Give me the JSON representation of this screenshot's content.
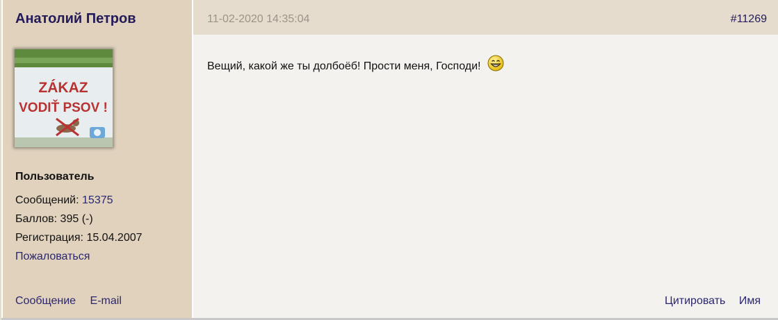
{
  "author": {
    "name": "Анатолий Петров",
    "avatar_text_line1": "ZÁKAZ",
    "avatar_text_line2": "VODIŤ PSOV !",
    "role": "Пользователь",
    "messages_label": "Сообщений:",
    "messages_count": "15375",
    "points_label": "Баллов:",
    "points_value": "395 (-)",
    "registration_label": "Регистрация:",
    "registration_date": "15.04.2007",
    "complain_label": "Пожаловаться",
    "actions": {
      "message_label": "Сообщение",
      "email_label": "E-mail"
    }
  },
  "post": {
    "date": "11-02-2020 14:35:04",
    "id": "#11269",
    "text": "Вещий, какой же ты долбоёб! Прости меня, Господи!",
    "smiley_icon": "grin-smiley-icon",
    "actions": {
      "quote_label": "Цитировать",
      "name_label": "Имя"
    }
  },
  "colors": {
    "sidebar_bg": "#e0d2bd",
    "header_bg": "#e6dccd",
    "body_bg": "#f3f2ee",
    "link": "#2a2670",
    "author": "#231a5a"
  }
}
